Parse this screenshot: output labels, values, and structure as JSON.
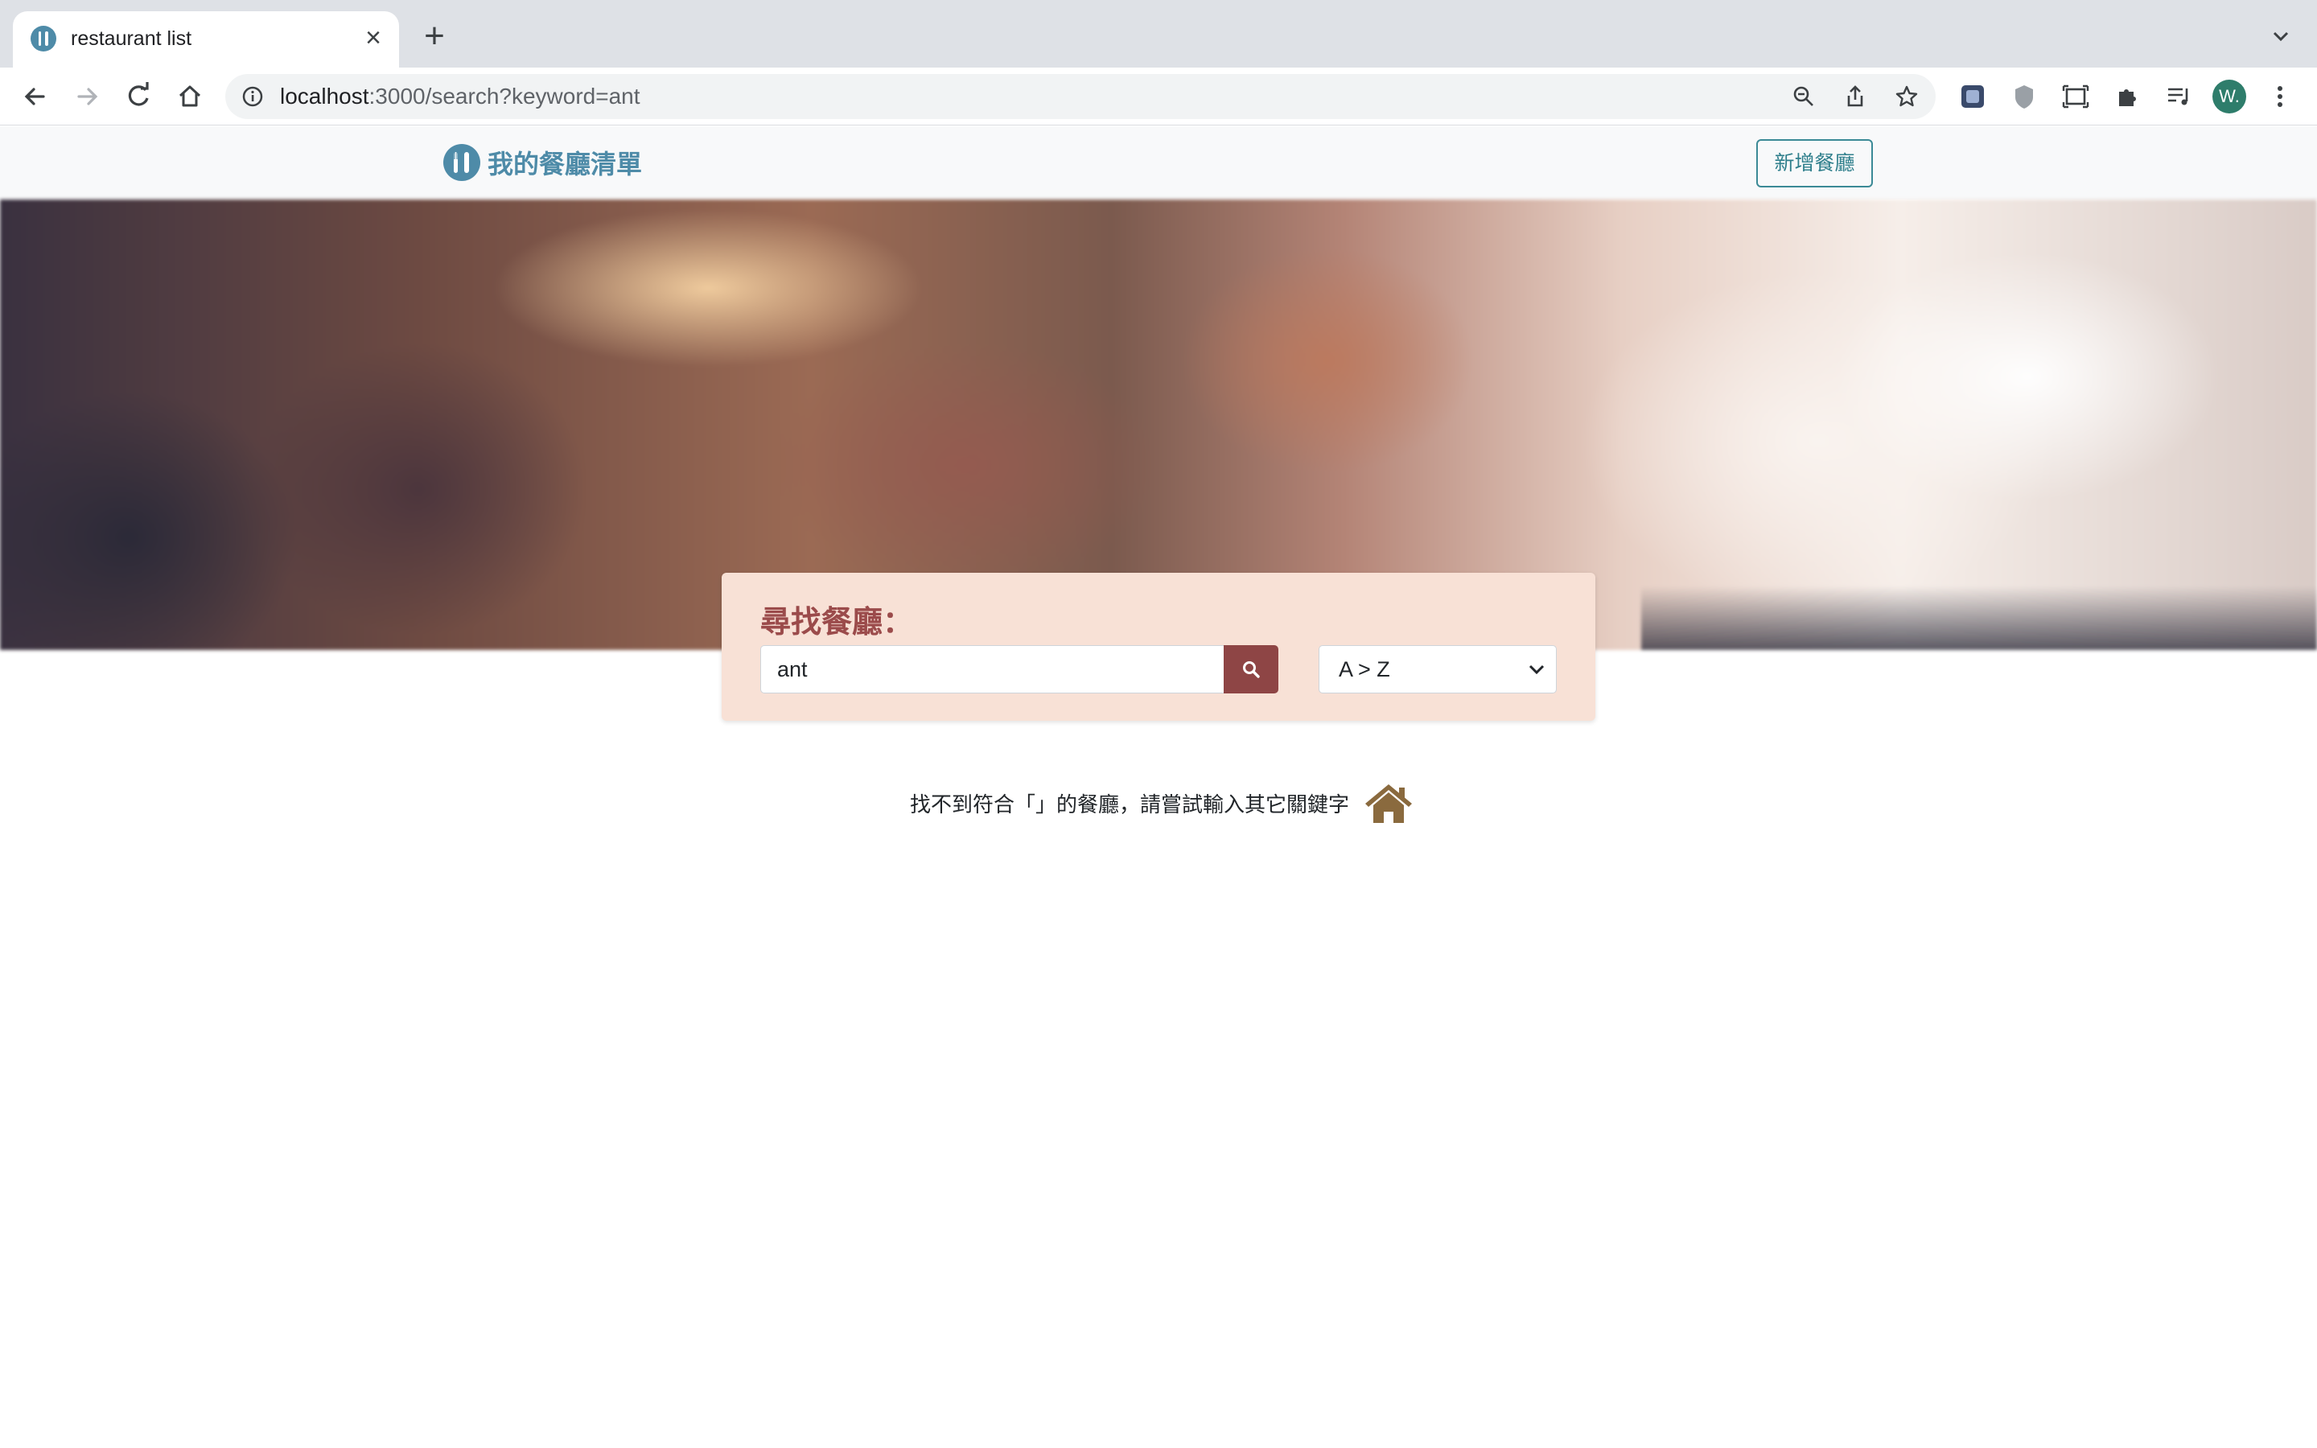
{
  "browser": {
    "tab_title": "restaurant list",
    "url_host": "localhost",
    "url_rest": ":3000/search?keyword=ant",
    "profile_initial": "W."
  },
  "navbar": {
    "brand": "我的餐廳清單",
    "add_button": "新增餐廳"
  },
  "search": {
    "title": "尋找餐廳：",
    "keyword": "ant",
    "sort_selected": "A > Z"
  },
  "results": {
    "empty_message": "找不到符合「」的餐廳，請嘗試輸入其它關鍵字"
  },
  "colors": {
    "brand": "#4e8ba8",
    "accent": "#8e4545",
    "card_bg": "#f8e1d6",
    "home_icon": "#8a6a3e"
  },
  "icons": [
    "utensils-icon",
    "search-icon",
    "home-icon"
  ]
}
